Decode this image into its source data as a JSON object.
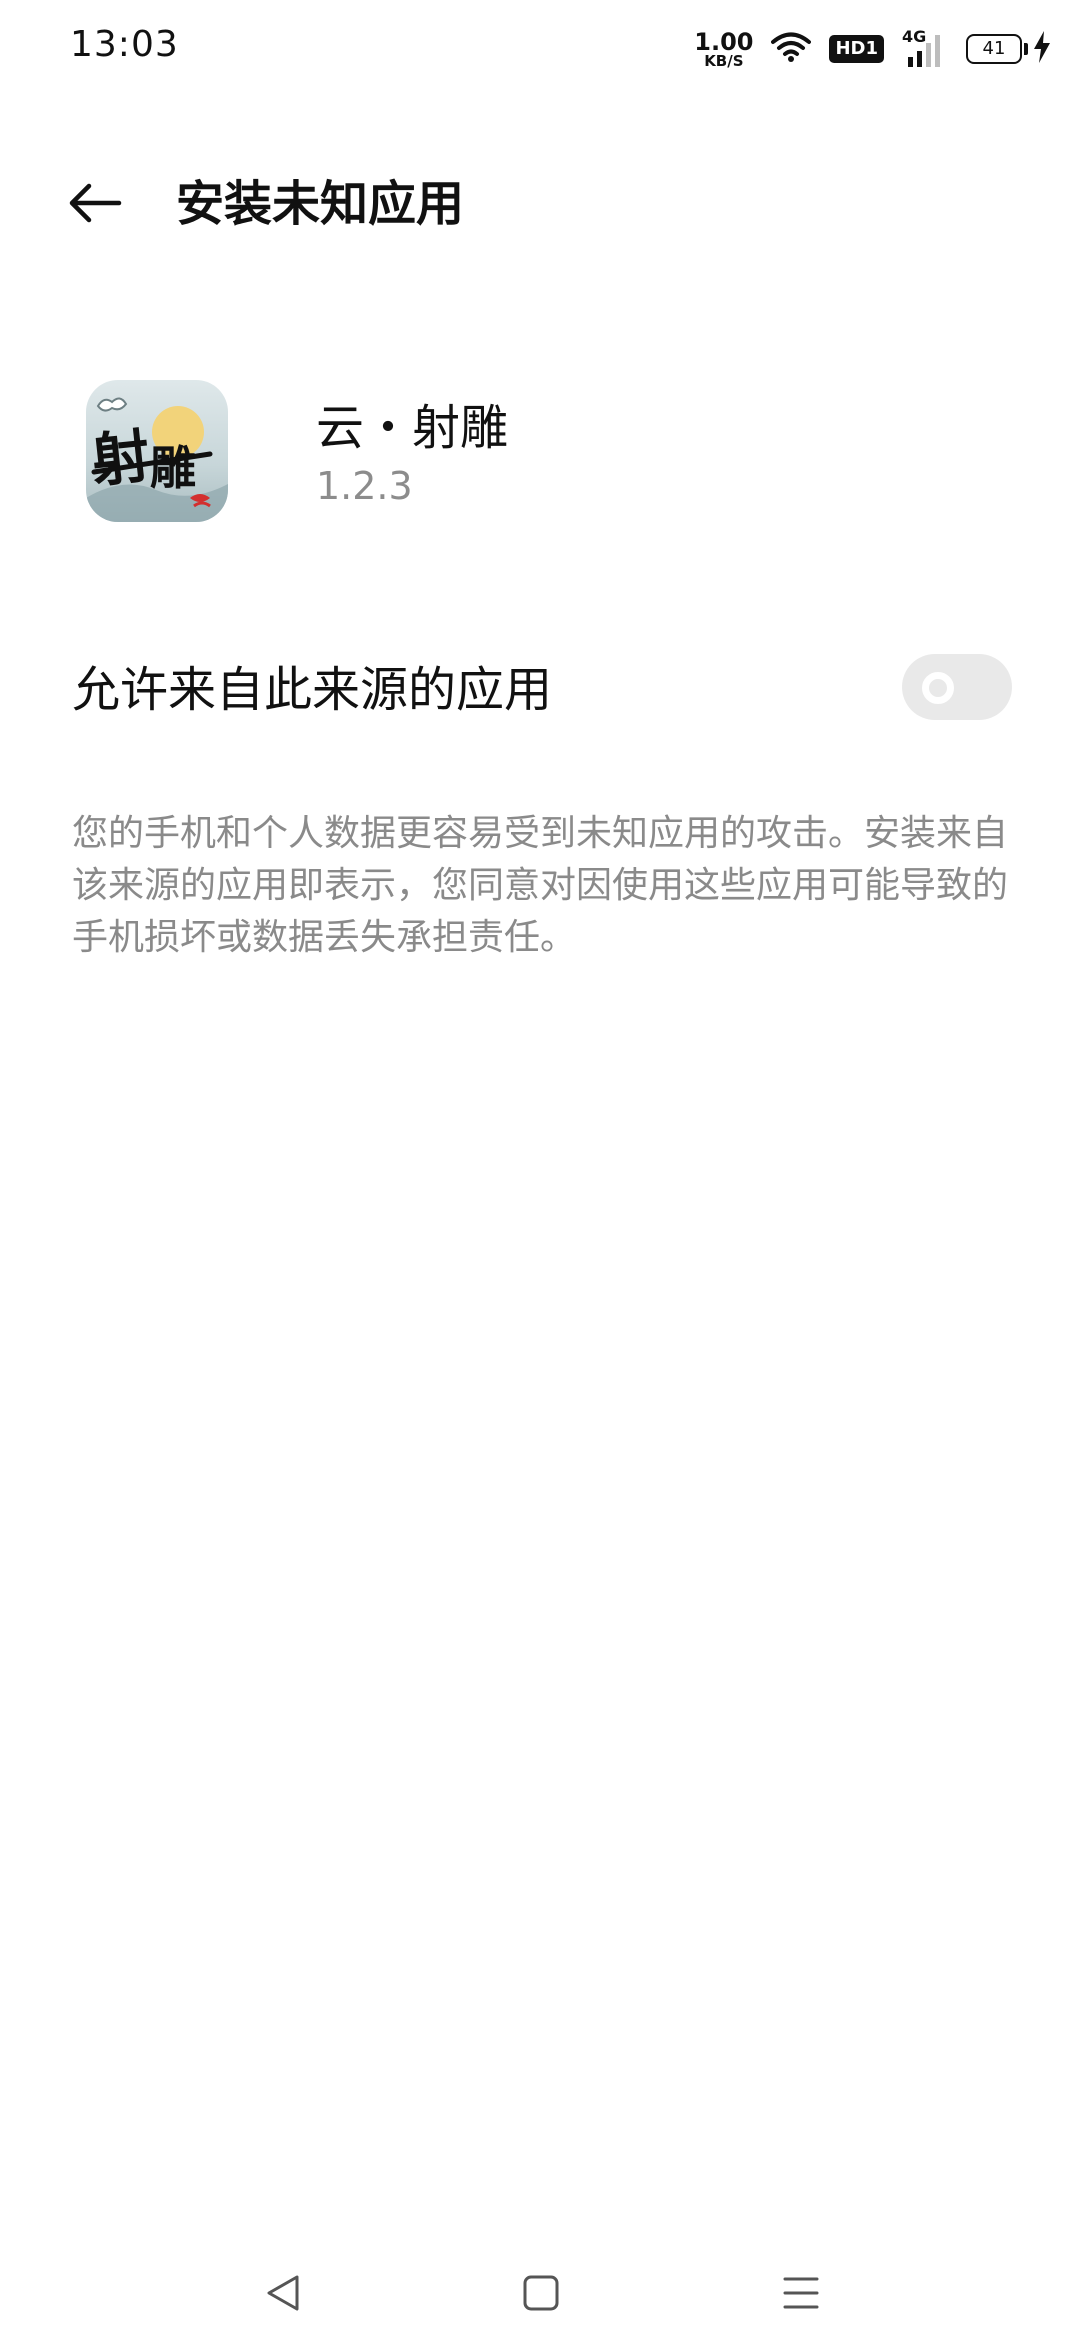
{
  "status_bar": {
    "time": "13:03",
    "net_speed_value": "1.00",
    "net_speed_unit": "KB/S",
    "hd_badge": "HD1",
    "network_type": "4G",
    "battery_level": "41",
    "icons": [
      "wifi-icon",
      "hd-badge",
      "signal-icon",
      "battery-icon",
      "charging-icon"
    ]
  },
  "header": {
    "title": "安装未知应用",
    "back_icon": "back-arrow-icon"
  },
  "app": {
    "name": "云・射雕",
    "version": "1.2.3",
    "icon_text": "射雕"
  },
  "setting": {
    "label": "允许来自此来源的应用",
    "enabled": false
  },
  "description": "您的手机和个人数据更容易受到未知应用的攻击。安装来自该来源的应用即表示，您同意对因使用这些应用可能导致的手机损坏或数据丢失承担责任。",
  "nav_bar": {
    "icons": [
      "back-triangle-icon",
      "home-square-icon",
      "menu-lines-icon"
    ]
  },
  "colors": {
    "background": "#ffffff",
    "text_primary": "#111111",
    "text_secondary": "#8a8a8a",
    "toggle_off": "#e9e9e9"
  }
}
